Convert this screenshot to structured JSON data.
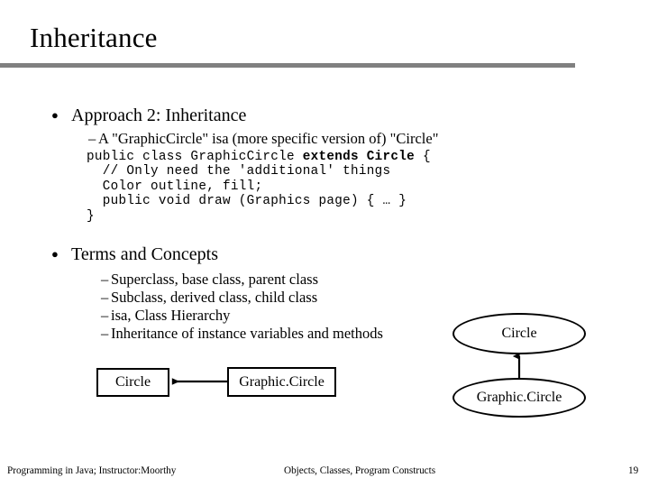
{
  "slide": {
    "title": "Inheritance",
    "rule_color": "#808080"
  },
  "content": {
    "bullet1": {
      "marker": "●",
      "text": "Approach 2: Inheritance",
      "sub": {
        "marker": "–",
        "text": "A \"GraphicCircle\" isa (more specific version of) \"Circle\""
      }
    },
    "code": {
      "line1_a": "public class GraphicCircle ",
      "line1_b": "extends Circle",
      "line1_c": " {",
      "line2": "  // Only need the 'additional' things",
      "line3": "  Color outline, fill;",
      "line4": "  public void draw (Graphics page) { … }",
      "line5": "}"
    },
    "bullet2": {
      "marker": "●",
      "text": "Terms and Concepts",
      "subs": [
        {
          "marker": "–",
          "text": "Superclass, base class, parent class"
        },
        {
          "marker": "–",
          "text": "Subclass, derived class, child class"
        },
        {
          "marker": "–",
          "text": "isa, Class Hierarchy"
        },
        {
          "marker": "–",
          "text": "Inheritance of instance variables and methods"
        }
      ]
    }
  },
  "diagrams": {
    "box_diagram": {
      "superclass_label": "Circle",
      "subclass_label": "Graphic.Circle"
    },
    "ellipse_diagram": {
      "superclass_label": "Circle",
      "subclass_label": "Graphic.Circle"
    }
  },
  "footer": {
    "left": "Programming in Java; Instructor:Moorthy",
    "center": "Objects, Classes, Program Constructs",
    "page_number": "19"
  }
}
